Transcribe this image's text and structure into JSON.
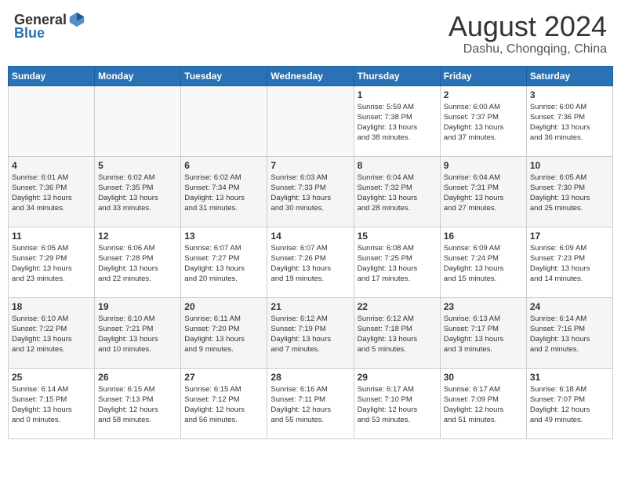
{
  "header": {
    "logo_general": "General",
    "logo_blue": "Blue",
    "month_title": "August 2024",
    "location": "Dashu, Chongqing, China"
  },
  "weekdays": [
    "Sunday",
    "Monday",
    "Tuesday",
    "Wednesday",
    "Thursday",
    "Friday",
    "Saturday"
  ],
  "weeks": [
    [
      {
        "day": "",
        "empty": true
      },
      {
        "day": "",
        "empty": true
      },
      {
        "day": "",
        "empty": true
      },
      {
        "day": "",
        "empty": true
      },
      {
        "day": "1",
        "sunrise": "5:59 AM",
        "sunset": "7:38 PM",
        "daylight": "13 hours and 38 minutes."
      },
      {
        "day": "2",
        "sunrise": "6:00 AM",
        "sunset": "7:37 PM",
        "daylight": "13 hours and 37 minutes."
      },
      {
        "day": "3",
        "sunrise": "6:00 AM",
        "sunset": "7:36 PM",
        "daylight": "13 hours and 36 minutes."
      }
    ],
    [
      {
        "day": "4",
        "sunrise": "6:01 AM",
        "sunset": "7:36 PM",
        "daylight": "13 hours and 34 minutes."
      },
      {
        "day": "5",
        "sunrise": "6:02 AM",
        "sunset": "7:35 PM",
        "daylight": "13 hours and 33 minutes."
      },
      {
        "day": "6",
        "sunrise": "6:02 AM",
        "sunset": "7:34 PM",
        "daylight": "13 hours and 31 minutes."
      },
      {
        "day": "7",
        "sunrise": "6:03 AM",
        "sunset": "7:33 PM",
        "daylight": "13 hours and 30 minutes."
      },
      {
        "day": "8",
        "sunrise": "6:04 AM",
        "sunset": "7:32 PM",
        "daylight": "13 hours and 28 minutes."
      },
      {
        "day": "9",
        "sunrise": "6:04 AM",
        "sunset": "7:31 PM",
        "daylight": "13 hours and 27 minutes."
      },
      {
        "day": "10",
        "sunrise": "6:05 AM",
        "sunset": "7:30 PM",
        "daylight": "13 hours and 25 minutes."
      }
    ],
    [
      {
        "day": "11",
        "sunrise": "6:05 AM",
        "sunset": "7:29 PM",
        "daylight": "13 hours and 23 minutes."
      },
      {
        "day": "12",
        "sunrise": "6:06 AM",
        "sunset": "7:28 PM",
        "daylight": "13 hours and 22 minutes."
      },
      {
        "day": "13",
        "sunrise": "6:07 AM",
        "sunset": "7:27 PM",
        "daylight": "13 hours and 20 minutes."
      },
      {
        "day": "14",
        "sunrise": "6:07 AM",
        "sunset": "7:26 PM",
        "daylight": "13 hours and 19 minutes."
      },
      {
        "day": "15",
        "sunrise": "6:08 AM",
        "sunset": "7:25 PM",
        "daylight": "13 hours and 17 minutes."
      },
      {
        "day": "16",
        "sunrise": "6:09 AM",
        "sunset": "7:24 PM",
        "daylight": "13 hours and 15 minutes."
      },
      {
        "day": "17",
        "sunrise": "6:09 AM",
        "sunset": "7:23 PM",
        "daylight": "13 hours and 14 minutes."
      }
    ],
    [
      {
        "day": "18",
        "sunrise": "6:10 AM",
        "sunset": "7:22 PM",
        "daylight": "13 hours and 12 minutes."
      },
      {
        "day": "19",
        "sunrise": "6:10 AM",
        "sunset": "7:21 PM",
        "daylight": "13 hours and 10 minutes."
      },
      {
        "day": "20",
        "sunrise": "6:11 AM",
        "sunset": "7:20 PM",
        "daylight": "13 hours and 9 minutes."
      },
      {
        "day": "21",
        "sunrise": "6:12 AM",
        "sunset": "7:19 PM",
        "daylight": "13 hours and 7 minutes."
      },
      {
        "day": "22",
        "sunrise": "6:12 AM",
        "sunset": "7:18 PM",
        "daylight": "13 hours and 5 minutes."
      },
      {
        "day": "23",
        "sunrise": "6:13 AM",
        "sunset": "7:17 PM",
        "daylight": "13 hours and 3 minutes."
      },
      {
        "day": "24",
        "sunrise": "6:14 AM",
        "sunset": "7:16 PM",
        "daylight": "13 hours and 2 minutes."
      }
    ],
    [
      {
        "day": "25",
        "sunrise": "6:14 AM",
        "sunset": "7:15 PM",
        "daylight": "13 hours and 0 minutes."
      },
      {
        "day": "26",
        "sunrise": "6:15 AM",
        "sunset": "7:13 PM",
        "daylight": "12 hours and 58 minutes."
      },
      {
        "day": "27",
        "sunrise": "6:15 AM",
        "sunset": "7:12 PM",
        "daylight": "12 hours and 56 minutes."
      },
      {
        "day": "28",
        "sunrise": "6:16 AM",
        "sunset": "7:11 PM",
        "daylight": "12 hours and 55 minutes."
      },
      {
        "day": "29",
        "sunrise": "6:17 AM",
        "sunset": "7:10 PM",
        "daylight": "12 hours and 53 minutes."
      },
      {
        "day": "30",
        "sunrise": "6:17 AM",
        "sunset": "7:09 PM",
        "daylight": "12 hours and 51 minutes."
      },
      {
        "day": "31",
        "sunrise": "6:18 AM",
        "sunset": "7:07 PM",
        "daylight": "12 hours and 49 minutes."
      }
    ]
  ]
}
